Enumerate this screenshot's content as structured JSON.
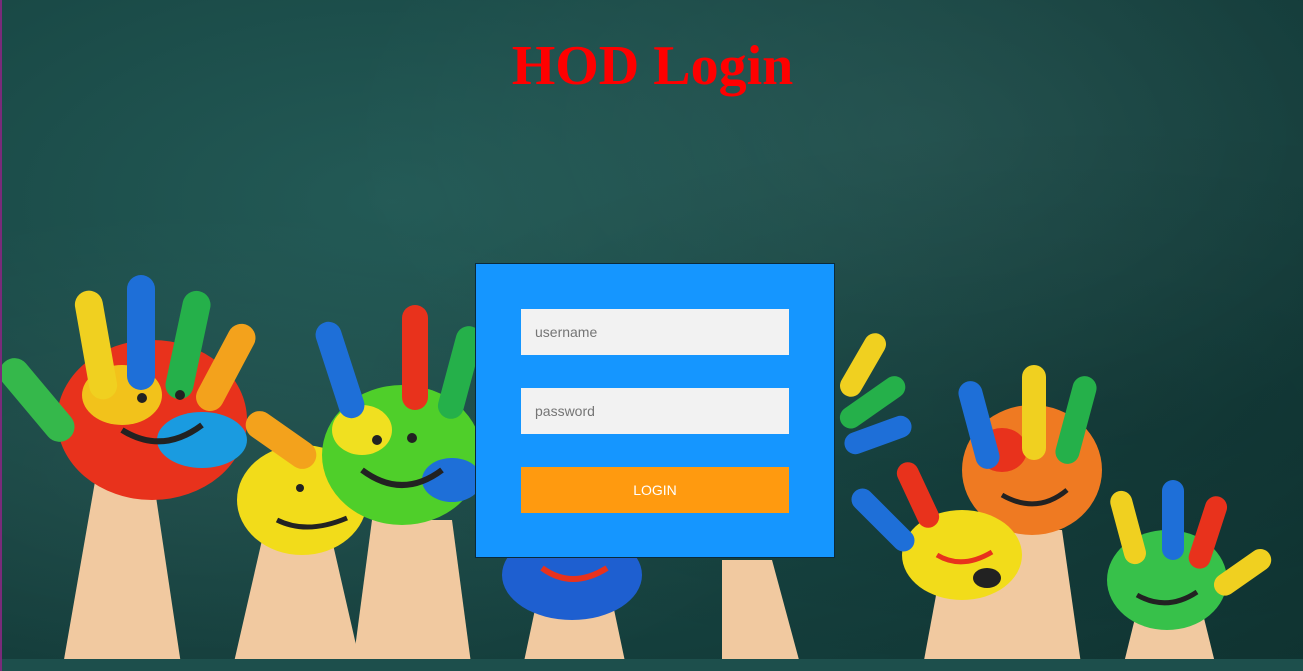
{
  "page": {
    "title": "HOD Login"
  },
  "login_form": {
    "username_placeholder": "username",
    "password_placeholder": "password",
    "username_value": "",
    "password_value": "",
    "login_label": "LOGIN"
  },
  "colors": {
    "title": "#ff0000",
    "panel_background": "#1596ff",
    "login_button": "#ff9a0f",
    "input_background": "#f2f2f2",
    "chalkboard": "#1a4a47"
  },
  "background": {
    "icon": "painted-hands-chalkboard-image"
  }
}
